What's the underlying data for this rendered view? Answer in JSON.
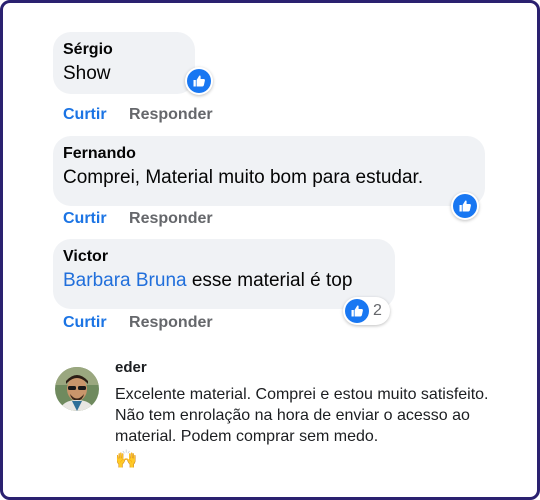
{
  "comments": [
    {
      "author": "Sérgio",
      "text": "Show",
      "reaction_count": "",
      "actions": {
        "like": "Curtir",
        "reply": "Responder"
      }
    },
    {
      "author": "Fernando",
      "text": "Comprei, Material muito bom para estudar.",
      "reaction_count": "",
      "actions": {
        "like": "Curtir",
        "reply": "Responder"
      }
    },
    {
      "author": "Victor",
      "mention": "Barbara Bruna",
      "text": " esse material é top",
      "reaction_count": "2",
      "actions": {
        "like": "Curtir",
        "reply": "Responder"
      }
    }
  ],
  "review": {
    "name": "eder",
    "text": "Excelente material. Comprei e estou muito satisfeito. Não tem enrolação na hora de enviar o acesso ao material. Podem comprar sem medo.",
    "emoji": "🙌"
  },
  "colors": {
    "frame": "#2a2170",
    "bubble": "#f0f2f5",
    "link": "#1b74e4",
    "mention": "#216fdb",
    "like_badge": "#1877f2"
  },
  "icons": {
    "reaction": "like-thumb-icon"
  }
}
